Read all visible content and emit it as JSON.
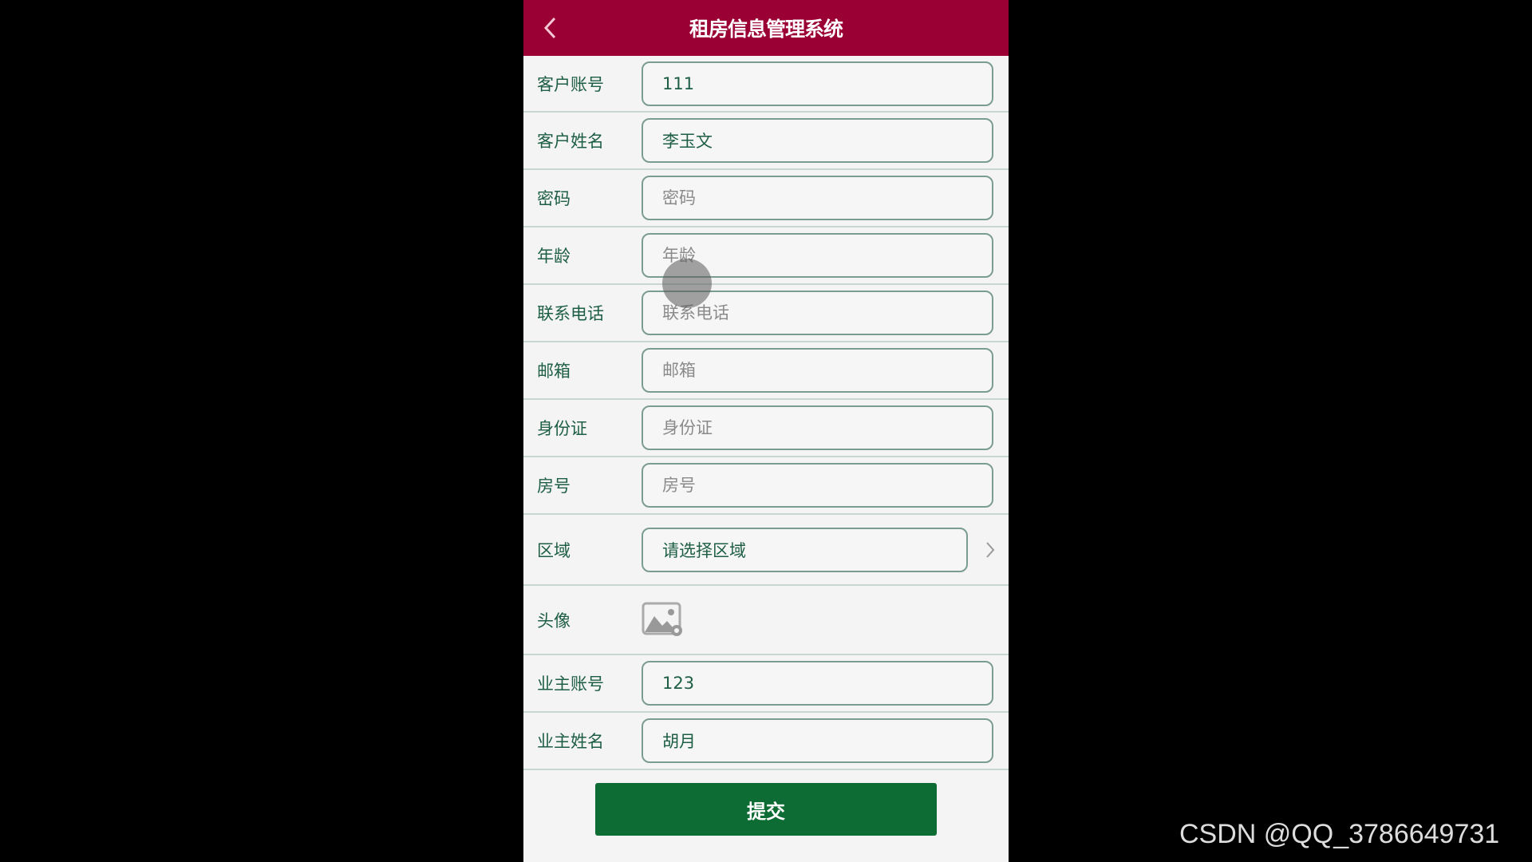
{
  "header": {
    "title": "租房信息管理系统",
    "back_icon": "chevron-left-icon"
  },
  "colors": {
    "header": "#9b0035",
    "button": "#0d6b34",
    "label": "#1d5e45"
  },
  "form": {
    "fields": [
      {
        "label": "客户账号",
        "value": "111",
        "placeholder": ""
      },
      {
        "label": "客户姓名",
        "value": "李玉文",
        "placeholder": ""
      },
      {
        "label": "密码",
        "value": "",
        "placeholder": "密码"
      },
      {
        "label": "年龄",
        "value": "",
        "placeholder": "年龄"
      },
      {
        "label": "联系电话",
        "value": "",
        "placeholder": "联系电话"
      },
      {
        "label": "邮箱",
        "value": "",
        "placeholder": "邮箱"
      },
      {
        "label": "身份证",
        "value": "",
        "placeholder": "身份证"
      },
      {
        "label": "房号",
        "value": "",
        "placeholder": "房号"
      }
    ],
    "region": {
      "label": "区域",
      "value": "请选择区域"
    },
    "avatar": {
      "label": "头像",
      "icon": "image-upload-icon"
    },
    "owner_fields": [
      {
        "label": "业主账号",
        "value": "123"
      },
      {
        "label": "业主姓名",
        "value": "胡月"
      }
    ],
    "submit_label": "提交"
  },
  "watermark": "CSDN @QQ_3786649731"
}
